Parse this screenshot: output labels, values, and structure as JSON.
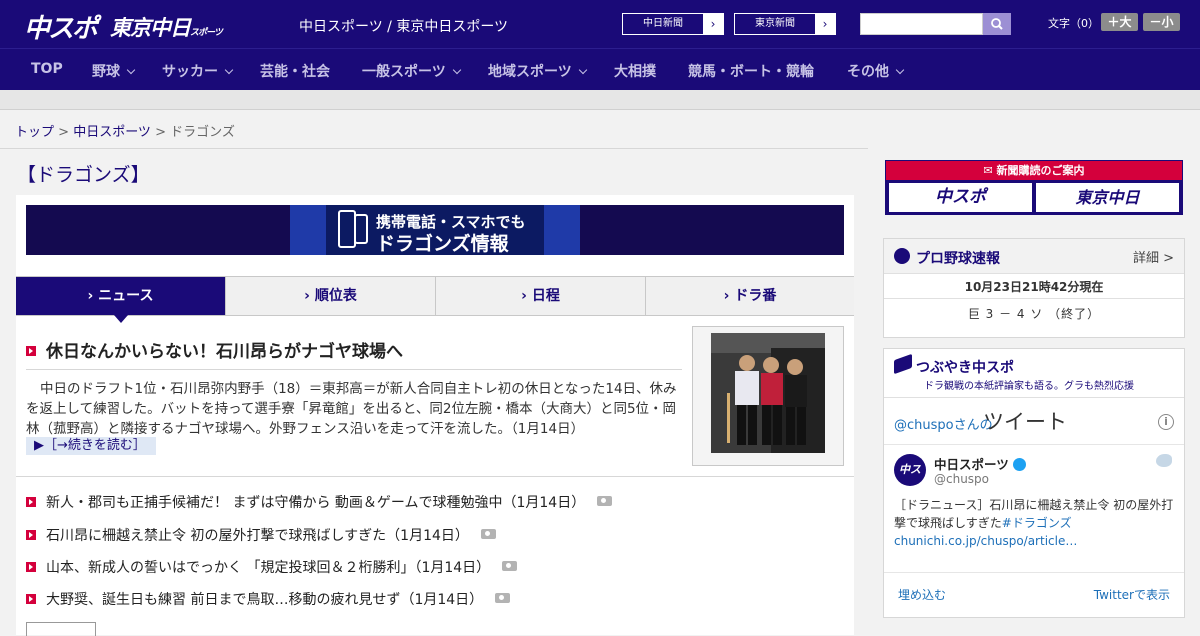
{
  "header": {
    "logo_chuspo": "中スポ",
    "logo_tokyo": "東京中日",
    "logo_tokyo_small": "スポーツ",
    "site_links": "中日スポーツ / 東京中日スポーツ",
    "paper_buttons": [
      {
        "label": "中日新聞",
        "arrow": "›"
      },
      {
        "label": "東京新聞",
        "arrow": "›"
      }
    ],
    "search": {
      "placeholder": "",
      "icon": "search-icon"
    },
    "font_size_label": "文字（0）",
    "font_larger": "＋大",
    "font_smaller": "－小"
  },
  "nav": {
    "items": [
      {
        "label": "TOP",
        "dropdown": false
      },
      {
        "label": "野球",
        "dropdown": true
      },
      {
        "label": "サッカー",
        "dropdown": true
      },
      {
        "label": "芸能・社会",
        "dropdown": false
      },
      {
        "label": "一般スポーツ",
        "dropdown": true
      },
      {
        "label": "地域スポーツ",
        "dropdown": true
      },
      {
        "label": "大相撲",
        "dropdown": false
      },
      {
        "label": "競馬・ボート・競輪",
        "dropdown": false
      },
      {
        "label": "その他",
        "dropdown": true
      }
    ]
  },
  "breadcrumb": {
    "top": "トップ",
    "sep1": " > ",
    "chunichi": "中日スポーツ",
    "sep2": " > ",
    "current": "ドラゴンズ"
  },
  "page_title": "【ドラゴンズ】",
  "banner": {
    "line1": "携帯電話・スマホでも",
    "line2": "ドラゴンズ情報"
  },
  "tabs": [
    {
      "label": "› ニュース",
      "active": true
    },
    {
      "label": "› 順位表",
      "active": false
    },
    {
      "label": "› 日程",
      "active": false
    },
    {
      "label": "› ドラ番",
      "active": false
    }
  ],
  "lead": {
    "title": "休日なんかいらない！石川昂らがナゴヤ球場へ",
    "body": "中日のドラフト1位・石川昂弥内野手（18）＝東邦高＝が新人合同自主トレ初の休日となった14日、休みを返上して練習した。バットを持って選手寮「昇竜館」を出ると、同2位左腕・橋本（大商大）と同5位・岡林（菰野高）と隣接するナゴヤ球場へ。外野フェンス沿いを走って汗を流した。（1月14日）",
    "read_more": "▶［→続きを読む］"
  },
  "news_list": [
    {
      "title": "新人・郡司も正捕手候補だ！ まずは守備から 動画＆ゲームで球種勉強中（1月14日）",
      "has_photo": true
    },
    {
      "title": "石川昂に柵越え禁止令 初の屋外打撃で球飛ばしすぎた（1月14日）",
      "has_photo": true
    },
    {
      "title": "山本、新成人の誓いはでっかく 「規定投球回＆２桁勝利」（1月14日）",
      "has_photo": true
    },
    {
      "title": "大野奨、誕生日も練習 前日まで鳥取…移動の疲れ見せず（1月14日）",
      "has_photo": true
    }
  ],
  "sidebar": {
    "subscribe": {
      "heading": "新聞購読のご案内",
      "btn_chuspo": "中スポ",
      "btn_tokyo": "東京中日"
    },
    "baseball": {
      "title": "プロ野球速報",
      "detail": "詳細 >",
      "timestamp": "10月23日21時42分現在",
      "score": "巨 3 － 4 ソ （終了）"
    },
    "twitter": {
      "title": "つぶやき中スポ",
      "subtitle": "ドラ観戦の本紙評論家も語る。グラも熱烈応援",
      "handle": "@chuspoさんの",
      "tweet_word": "ツイート",
      "account_name": "中日スポーツ",
      "account_user": "@chuspo",
      "avatar": "中スポ",
      "tweet_text": "［ドラニュース］石川昂に柵越え禁止令 初の屋外打撃で球飛ばしすぎた",
      "tweet_tag": "#ドラゴンズ",
      "tweet_link": "chunichi.co.jp/chuspo/article…",
      "embed": "埋め込む",
      "view_on": "Twitterで表示"
    }
  }
}
